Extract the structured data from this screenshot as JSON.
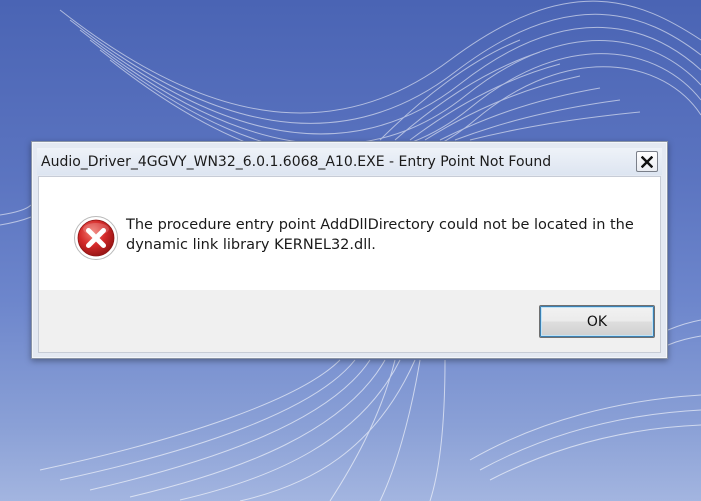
{
  "dialog": {
    "title": "Audio_Driver_4GGVY_WN32_6.0.1.6068_A10.EXE - Entry Point Not Found",
    "message": "The procedure entry point AddDllDirectory could not be located in the dynamic link library KERNEL32.dll.",
    "ok_label": "OK",
    "icon": "error-icon",
    "close_icon": "close-icon"
  },
  "colors": {
    "desktop_background": "#5b74c0",
    "error_red": "#d42a2a",
    "dialog_frame": "#e4e9f2"
  }
}
